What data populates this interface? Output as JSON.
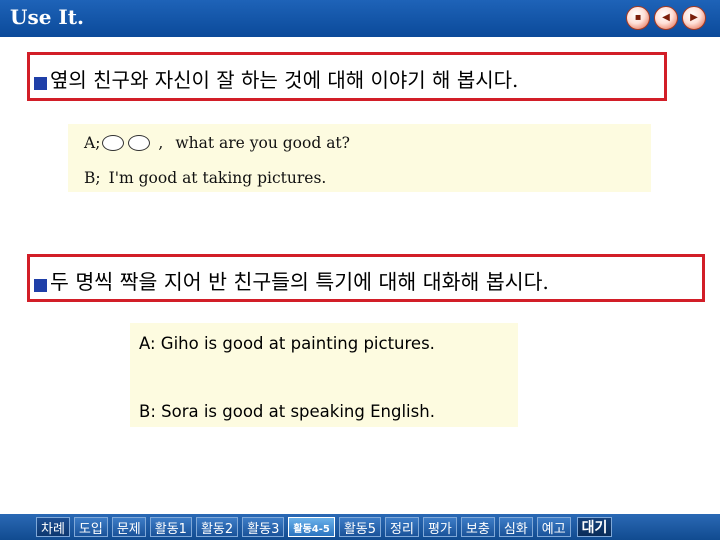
{
  "header": {
    "title": "Use It.",
    "nav": [
      {
        "name": "home-icon",
        "glyph": "▪"
      },
      {
        "name": "back-icon",
        "glyph": "◀"
      },
      {
        "name": "forward-icon",
        "glyph": "▶"
      }
    ],
    "color": "#0b4a9a"
  },
  "instruction1": {
    "text": "옆의 친구와 자신이 잘 하는 것에 대해 이야기 해 봅시다."
  },
  "dialog1": {
    "line_a": {
      "speaker": "A;",
      "comma": ",",
      "text": "what are you good at?"
    },
    "line_b": {
      "speaker": "B;",
      "text": "I'm good at taking pictures."
    }
  },
  "instruction2": {
    "text": "두 명씩 짝을 지어 반 친구들의 특기에 대해  대화해 봅시다."
  },
  "dialog2": {
    "line_a": "A: Giho is good at painting pictures.",
    "line_b": "B: Sora is good at speaking English."
  },
  "footer": {
    "items": [
      "차례",
      "도입",
      "문제",
      "활동1",
      "활동2",
      "활동3",
      "활동4-5",
      "활동5",
      "정리",
      "평가",
      "보충",
      "심화",
      "예고",
      "대기"
    ],
    "active_index": 6
  },
  "colors": {
    "accent_border": "#d21e28",
    "bullet": "#1f3fa8",
    "dialog_bg": "#fdfbe0"
  }
}
